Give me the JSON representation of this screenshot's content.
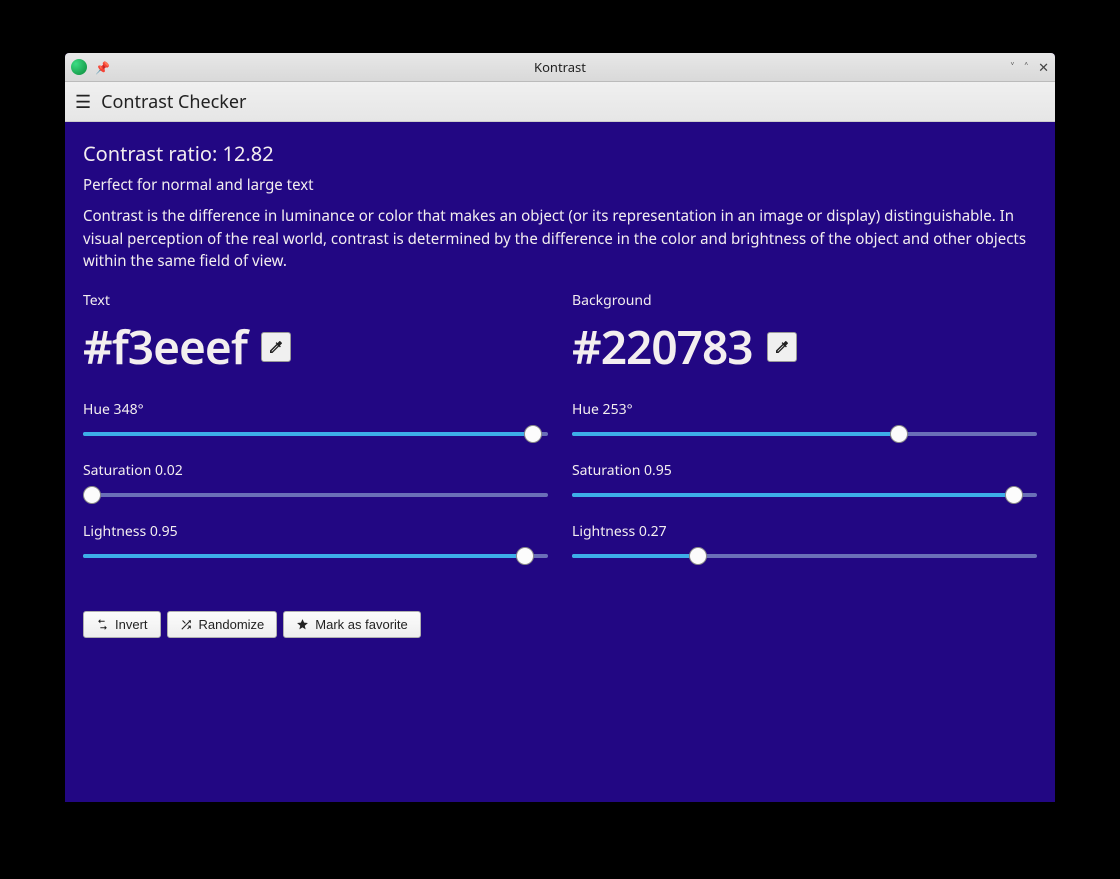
{
  "window": {
    "title": "Kontrast"
  },
  "toolbar": {
    "page_title": "Contrast Checker"
  },
  "ratio": {
    "label": "Contrast ratio: ",
    "value": "12.82"
  },
  "rating": "Perfect for normal and large text",
  "description": "Contrast is the difference in luminance or color that makes an object (or its representation in an image or display) distinguishable. In visual perception of the real world, contrast is determined by the difference in the color and brightness of the object and other objects within the same field of view.",
  "text_color": {
    "label": "Text",
    "hex": "#f3eeef",
    "hue_label": "Hue 348°",
    "hue_pct": 96.7,
    "sat_label": "Saturation 0.02",
    "sat_pct": 2,
    "light_label": "Lightness 0.95",
    "light_pct": 95
  },
  "bg_color": {
    "label": "Background",
    "hex": "#220783",
    "hue_label": "Hue 253°",
    "hue_pct": 70.3,
    "sat_label": "Saturation 0.95",
    "sat_pct": 95,
    "light_label": "Lightness 0.27",
    "light_pct": 27
  },
  "actions": {
    "invert": "Invert",
    "randomize": "Randomize",
    "favorite": "Mark as favorite"
  }
}
